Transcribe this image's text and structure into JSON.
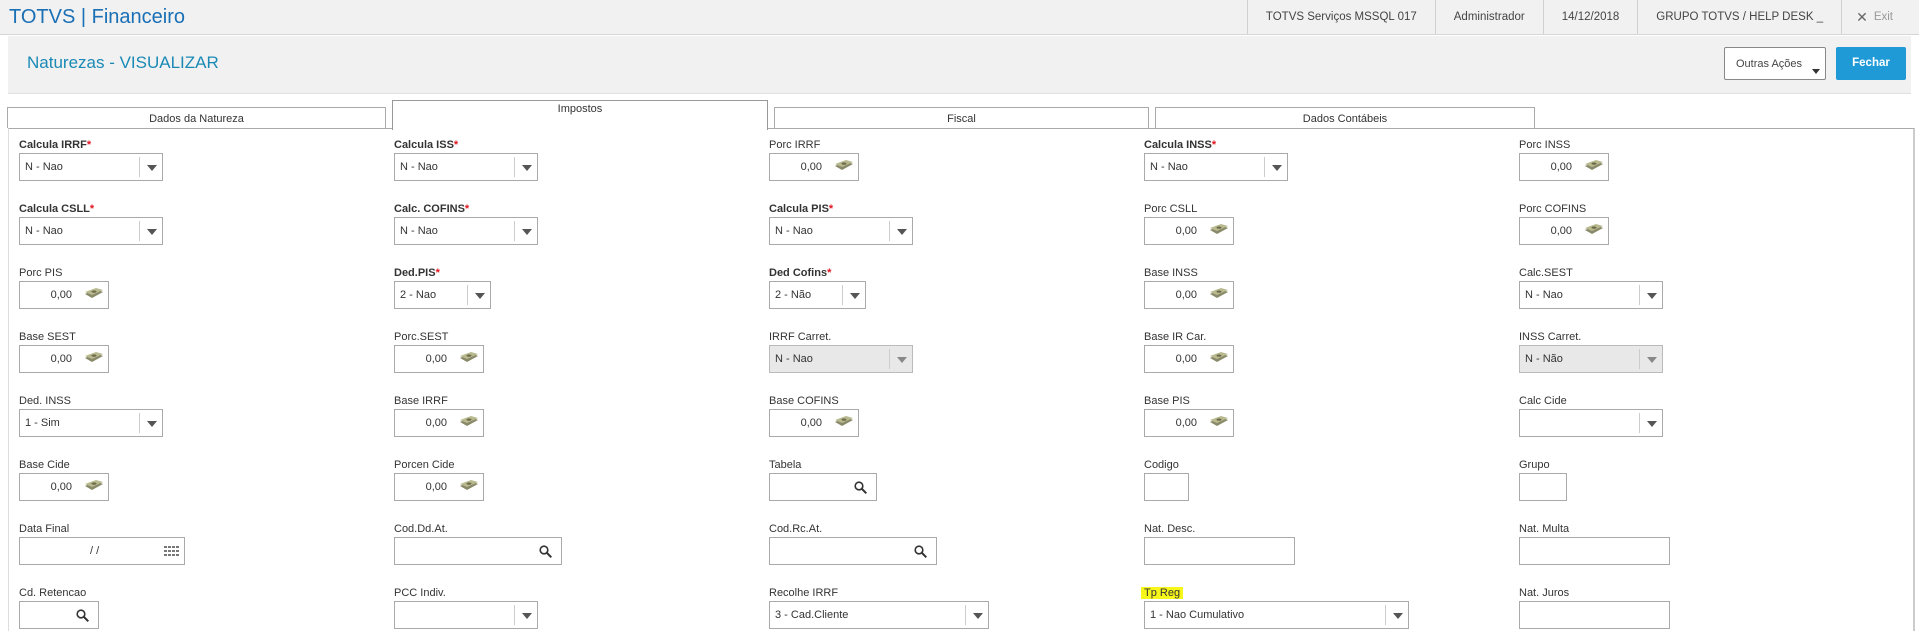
{
  "topbar": {
    "brand": "TOTVS | Financeiro",
    "environment": "TOTVS Serviços MSSQL 017",
    "user": "Administrador",
    "date": "14/12/2018",
    "company": "GRUPO TOTVS / HELP DESK _",
    "exit_icon": "close-icon",
    "exit_label": "Exit"
  },
  "header": {
    "title": "Naturezas - VISUALIZAR",
    "actions_label": "Outras Ações",
    "close_label": "Fechar"
  },
  "tabs": [
    {
      "label": "Dados da Natureza",
      "active": false
    },
    {
      "label": "Impostos",
      "active": true
    },
    {
      "label": "Fiscal",
      "active": false
    },
    {
      "label": "Dados Contábeis",
      "active": false
    }
  ],
  "colors": {
    "brand": "#1a6fb5",
    "title": "#1a8ab5",
    "primary_button": "#1f9ad6",
    "required": "#e0141e",
    "highlight": "#f6f61a"
  },
  "fields": [
    {
      "label": "Calcula IRRF",
      "required": true,
      "type": "select",
      "value": "N - Nao"
    },
    {
      "label": "Calcula ISS",
      "required": true,
      "type": "select",
      "value": "N - Nao"
    },
    {
      "label": "Porc IRRF",
      "required": false,
      "type": "money",
      "value": "0,00"
    },
    {
      "label": "Calcula INSS",
      "required": true,
      "type": "select",
      "value": "N - Nao"
    },
    {
      "label": "Porc INSS",
      "required": false,
      "type": "money",
      "value": "0,00"
    },
    {
      "label": "Calcula CSLL",
      "required": true,
      "type": "select",
      "value": "N - Nao"
    },
    {
      "label": "Calc. COFINS",
      "required": true,
      "type": "select",
      "value": "N - Nao"
    },
    {
      "label": "Calcula PIS",
      "required": true,
      "type": "select",
      "value": "N - Nao"
    },
    {
      "label": "Porc CSLL",
      "required": false,
      "type": "money",
      "value": "0,00"
    },
    {
      "label": "Porc COFINS",
      "required": false,
      "type": "money",
      "value": "0,00"
    },
    {
      "label": "Porc PIS",
      "required": false,
      "type": "money",
      "value": "0,00"
    },
    {
      "label": "Ded.PIS",
      "required": true,
      "type": "select",
      "value": "2 - Nao"
    },
    {
      "label": "Ded Cofins",
      "required": true,
      "type": "select",
      "value": "2 - Não"
    },
    {
      "label": "Base INSS",
      "required": false,
      "type": "money",
      "value": "0,00"
    },
    {
      "label": "Calc.SEST",
      "required": false,
      "type": "select",
      "value": "N - Nao"
    },
    {
      "label": "Base SEST",
      "required": false,
      "type": "money",
      "value": "0,00"
    },
    {
      "label": "Porc.SEST",
      "required": false,
      "type": "money",
      "value": "0,00"
    },
    {
      "label": "IRRF Carret.",
      "required": false,
      "type": "select",
      "value": "N - Nao",
      "disabled": true
    },
    {
      "label": "Base IR Car.",
      "required": false,
      "type": "money",
      "value": "0,00"
    },
    {
      "label": "INSS Carret.",
      "required": false,
      "type": "select",
      "value": "N - Não",
      "disabled": true
    },
    {
      "label": "Ded. INSS",
      "required": false,
      "type": "select",
      "value": "1 - Sim"
    },
    {
      "label": "Base IRRF",
      "required": false,
      "type": "money",
      "value": "0,00"
    },
    {
      "label": "Base COFINS",
      "required": false,
      "type": "money",
      "value": "0,00"
    },
    {
      "label": "Base PIS",
      "required": false,
      "type": "money",
      "value": "0,00"
    },
    {
      "label": "Calc Cide",
      "required": false,
      "type": "select",
      "value": ""
    },
    {
      "label": "Base Cide",
      "required": false,
      "type": "money",
      "value": "0,00"
    },
    {
      "label": "Porcen Cide",
      "required": false,
      "type": "money",
      "value": "0,00"
    },
    {
      "label": "Tabela",
      "required": false,
      "type": "search",
      "value": ""
    },
    {
      "label": "Codigo",
      "required": false,
      "type": "text",
      "value": ""
    },
    {
      "label": "Grupo",
      "required": false,
      "type": "text",
      "value": ""
    },
    {
      "label": "Data Final",
      "required": false,
      "type": "date",
      "value": "/ /"
    },
    {
      "label": "Cod.Dd.At.",
      "required": false,
      "type": "search",
      "value": ""
    },
    {
      "label": "Cod.Rc.At.",
      "required": false,
      "type": "search",
      "value": ""
    },
    {
      "label": "Nat. Desc.",
      "required": false,
      "type": "text",
      "value": ""
    },
    {
      "label": "Nat. Multa",
      "required": false,
      "type": "text",
      "value": ""
    },
    {
      "label": "Cd. Retencao",
      "required": false,
      "type": "search",
      "value": ""
    },
    {
      "label": "PCC Indiv.",
      "required": false,
      "type": "select",
      "value": ""
    },
    {
      "label": "Recolhe IRRF",
      "required": false,
      "type": "select",
      "value": "3 - Cad.Cliente"
    },
    {
      "label": "Tp Reg",
      "required": false,
      "type": "select",
      "value": "1 - Nao Cumulativo",
      "highlighted": true
    },
    {
      "label": "Nat. Juros",
      "required": false,
      "type": "text",
      "value": ""
    }
  ]
}
